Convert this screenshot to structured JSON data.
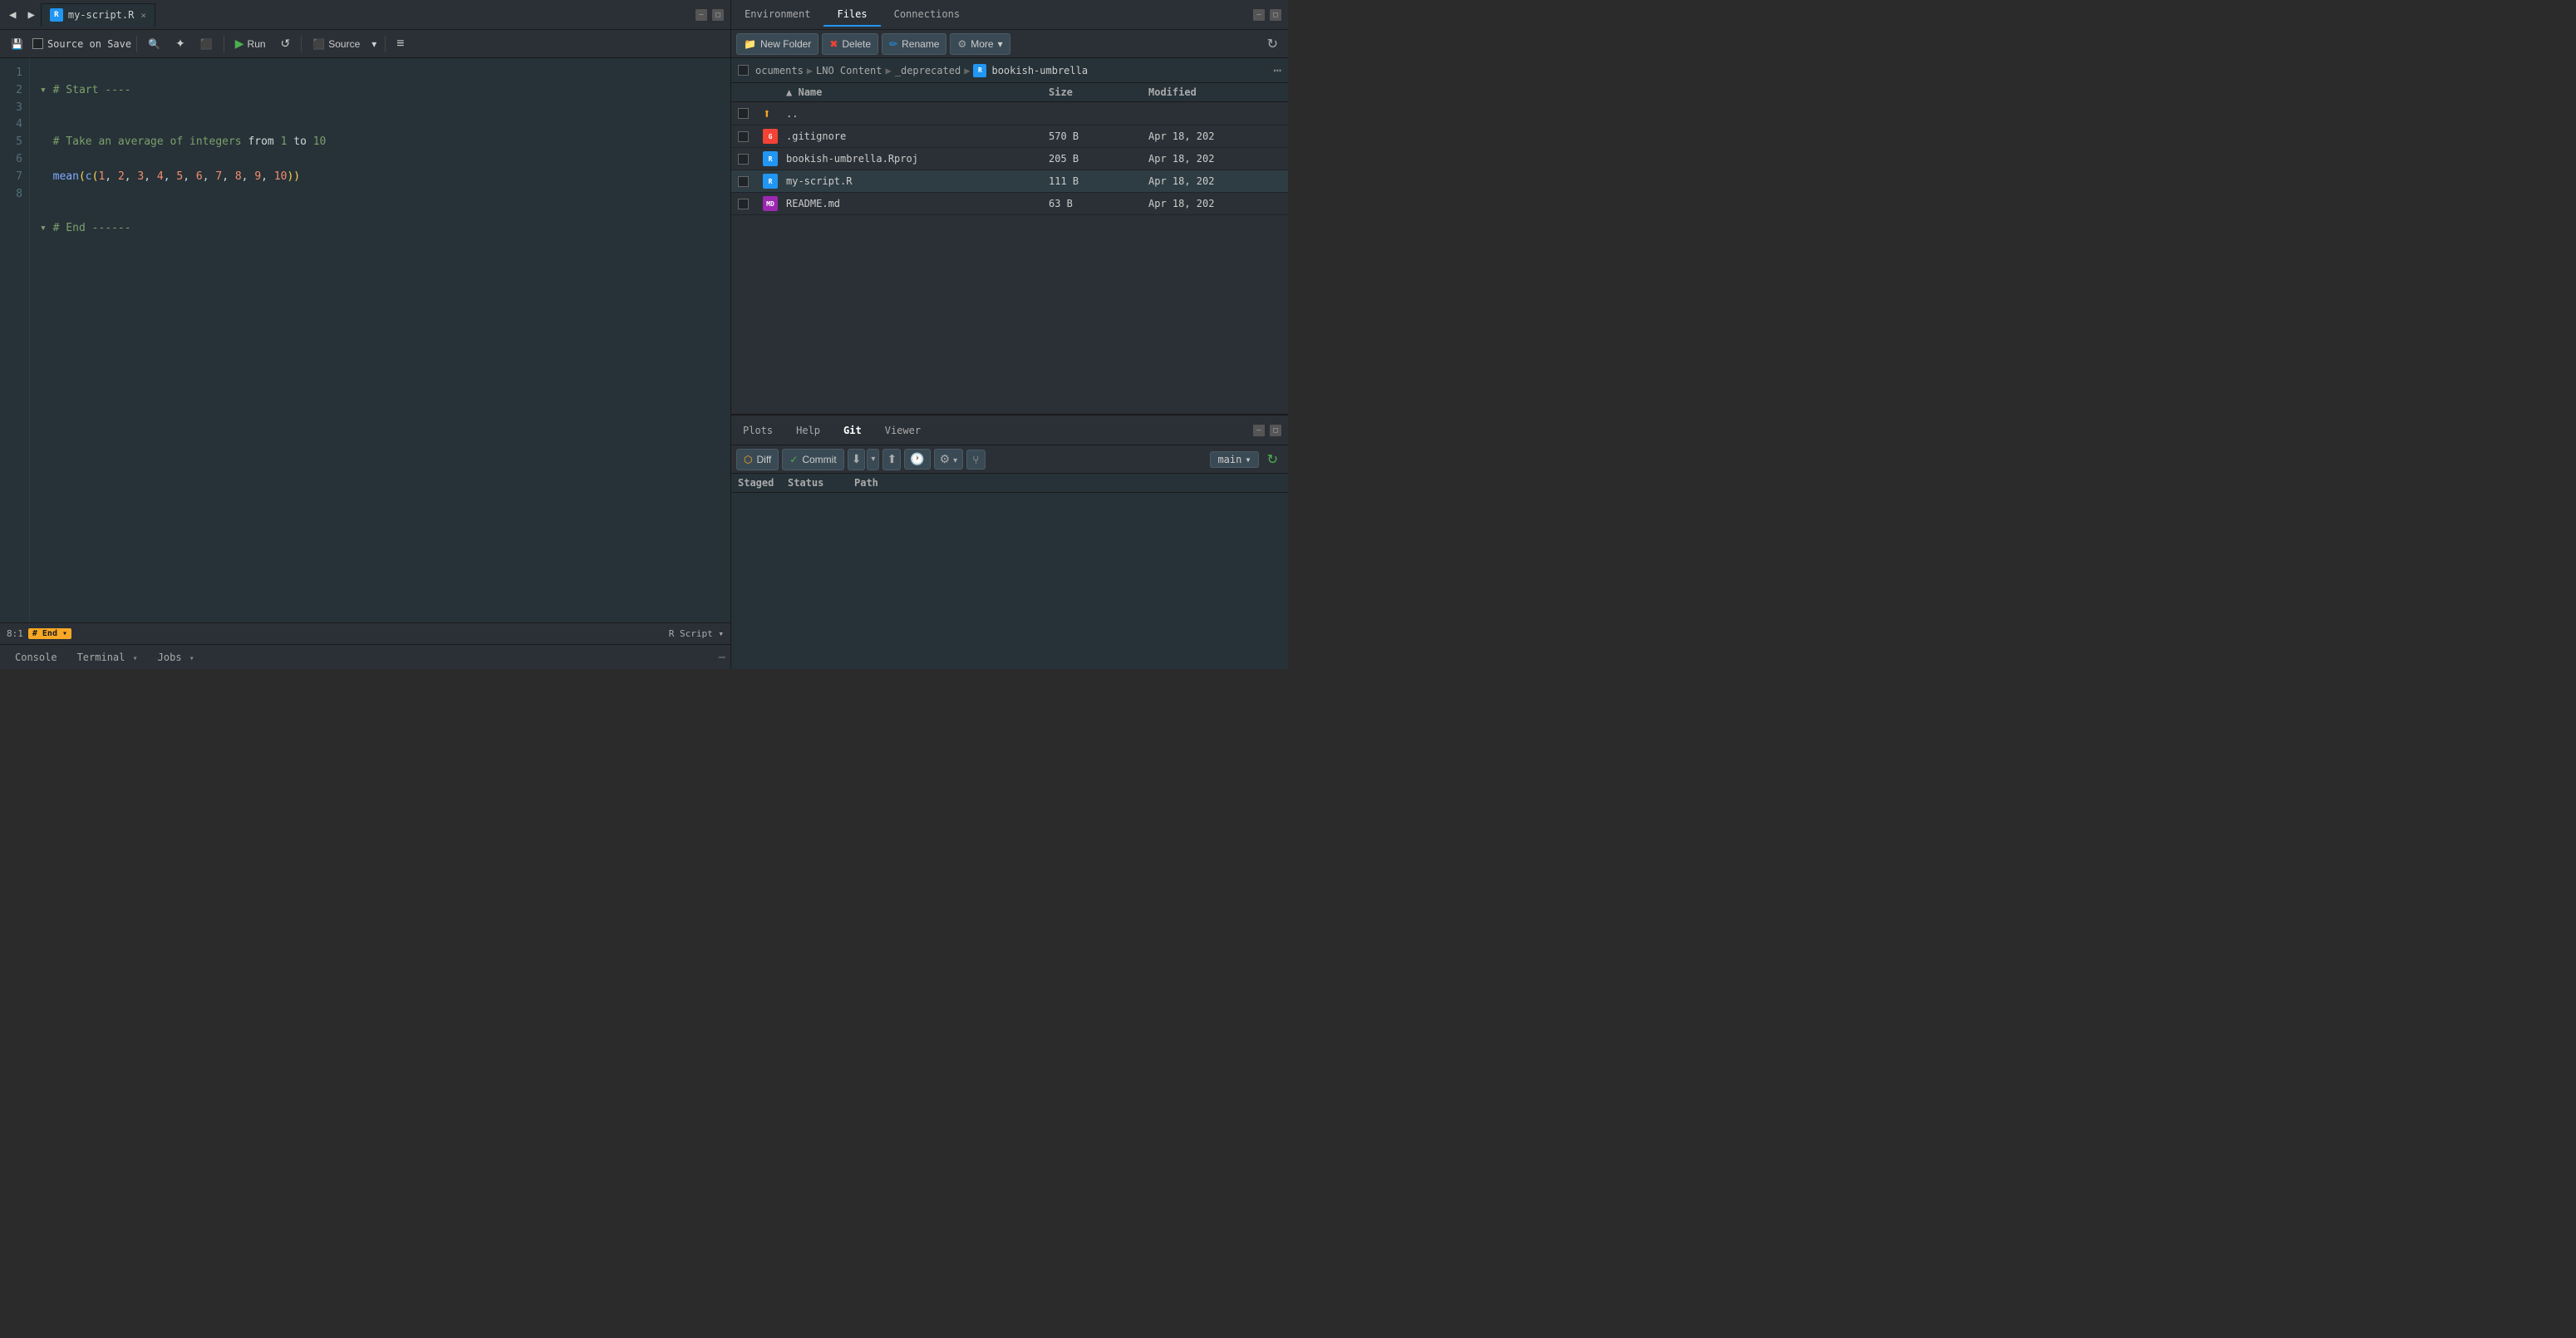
{
  "editor": {
    "tab_name": "my-script.R",
    "tab_close": "×",
    "toolbar": {
      "nav_back": "◀",
      "nav_forward": "▶",
      "save_icon": "💾",
      "source_on_save_label": "Source on Save",
      "find_icon": "🔍",
      "wand_icon": "✨",
      "square_icon": "⬛",
      "run_label": "Run",
      "re_run_icon": "↺",
      "source_label": "Source",
      "source_dropdown": "▾",
      "lines_icon": "≡"
    },
    "code_lines": [
      {
        "num": "1",
        "content": ""
      },
      {
        "num": "2",
        "content": "# Start ----"
      },
      {
        "num": "3",
        "content": ""
      },
      {
        "num": "4",
        "content": "# Take an average of integers from 1 to 10"
      },
      {
        "num": "5",
        "content": "mean(c(1, 2, 3, 4, 5, 6, 7, 8, 9, 10))"
      },
      {
        "num": "6",
        "content": ""
      },
      {
        "num": "7",
        "content": "# End ------"
      },
      {
        "num": "8",
        "content": ""
      }
    ],
    "status": {
      "position": "8:1",
      "badge_label": "# End",
      "badge_arrow": "▾",
      "script_type": "R Script",
      "script_arrow": "▾"
    },
    "bottom_tabs": [
      {
        "label": "Console",
        "active": false
      },
      {
        "label": "Terminal",
        "active": false,
        "arrow": "▾"
      },
      {
        "label": "Jobs",
        "active": false,
        "arrow": "▾"
      }
    ]
  },
  "files_panel": {
    "tabs": [
      {
        "label": "Environment",
        "active": false
      },
      {
        "label": "Files",
        "active": true
      },
      {
        "label": "Connections",
        "active": false
      }
    ],
    "toolbar": {
      "new_folder_label": "New Folder",
      "delete_label": "Delete",
      "rename_label": "Rename",
      "more_label": "More",
      "more_arrow": "▾"
    },
    "breadcrumb": {
      "segments": [
        "ocuments",
        "LNO Content",
        "_deprecated",
        "bookish-umbrella"
      ],
      "separators": [
        "▶",
        "▶",
        "▶"
      ]
    },
    "table_headers": {
      "name_col": "Name",
      "sort_icon": "▲",
      "size_col": "Size",
      "modified_col": "Modified"
    },
    "files": [
      {
        "type": "folder_up",
        "name": "..",
        "size": "",
        "modified": ""
      },
      {
        "type": "git",
        "icon_text": "G",
        "name": ".gitignore",
        "size": "570 B",
        "modified": "Apr 18, 202"
      },
      {
        "type": "rproj",
        "icon_text": "R",
        "name": "bookish-umbrella.Rproj",
        "size": "205 B",
        "modified": "Apr 18, 202"
      },
      {
        "type": "r",
        "icon_text": "R",
        "name": "my-script.R",
        "size": "111 B",
        "modified": "Apr 18, 202"
      },
      {
        "type": "md",
        "icon_text": "MD",
        "name": "README.md",
        "size": "63 B",
        "modified": "Apr 18, 202"
      }
    ]
  },
  "git_panel": {
    "tabs": [
      {
        "label": "Plots",
        "active": false
      },
      {
        "label": "Help",
        "active": false
      },
      {
        "label": "Git",
        "active": true
      },
      {
        "label": "Viewer",
        "active": false
      }
    ],
    "toolbar": {
      "diff_label": "Diff",
      "commit_label": "Commit",
      "pull_icon": "⬇",
      "pull_arrow": "▾",
      "push_icon": "⬆",
      "history_icon": "🕐",
      "settings_icon": "⚙",
      "settings_arrow": "▾",
      "branch_icon": "⑂",
      "branch_name": "main",
      "branch_arrow": "▾",
      "refresh_icon": "↻"
    },
    "table_headers": {
      "staged_col": "Staged",
      "status_col": "Status",
      "path_col": "Path"
    }
  },
  "colors": {
    "accent_blue": "#2196f3",
    "accent_green": "#4caf50",
    "accent_yellow": "#f9a825",
    "bg_dark": "#263238",
    "bg_mid": "#2b3036",
    "text_dim": "#546e7a"
  }
}
